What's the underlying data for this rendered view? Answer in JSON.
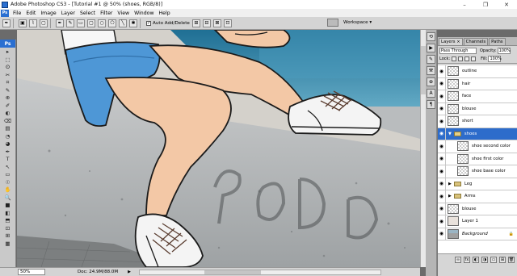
{
  "app": {
    "title": "Adobe Photoshop CS3 - [Tutorial #1 @ 50% (shoes, RGB/8)]",
    "badge": "Ps"
  },
  "window_controls": {
    "minimize": "–",
    "maximize": "❐",
    "close": "✕"
  },
  "menu": [
    "File",
    "Edit",
    "Image",
    "Layer",
    "Select",
    "Filter",
    "View",
    "Window",
    "Help"
  ],
  "options_bar": {
    "auto_add_delete_label": "Auto Add/Delete",
    "auto_add_delete_checked": true,
    "workspace_label": "Workspace ▾"
  },
  "toolbox": {
    "badge": "Ps",
    "tool_glyphs": [
      "▸",
      "⬚",
      "ʘ",
      "✂",
      "⌗",
      "✎",
      "⊕",
      "✐",
      "◐",
      "⌫",
      "▤",
      "◔",
      "◕",
      "✒",
      "T",
      "↖",
      "▭",
      "☉",
      "✋",
      "🔍",
      "■",
      "◧",
      "⬒",
      "⊡",
      "⊞",
      "▦"
    ]
  },
  "status": {
    "zoom": "50%",
    "doc": "Doc: 24.9M/88.0M"
  },
  "layers_panel": {
    "tabs": [
      "Layers ×",
      "Channels",
      "Paths"
    ],
    "active_tab": "Layers ×",
    "blend_mode": "Pass Through",
    "opacity_label": "Opacity:",
    "opacity_value": "100%",
    "lock_label": "Lock:",
    "fill_label": "Fill:",
    "fill_value": "100%",
    "layers": [
      {
        "name": "outline",
        "kind": "layer",
        "indent": false,
        "selected": false
      },
      {
        "name": "hair",
        "kind": "layer",
        "indent": false,
        "selected": false
      },
      {
        "name": "face",
        "kind": "layer",
        "indent": false,
        "selected": false
      },
      {
        "name": "blouse",
        "kind": "layer",
        "indent": false,
        "selected": false
      },
      {
        "name": "short",
        "kind": "layer",
        "indent": false,
        "selected": false
      },
      {
        "name": "shoes",
        "kind": "group-open",
        "indent": false,
        "selected": true
      },
      {
        "name": "shoe second color",
        "kind": "layer",
        "indent": true,
        "selected": false
      },
      {
        "name": "shoe first color",
        "kind": "layer",
        "indent": true,
        "selected": false
      },
      {
        "name": "shoe base color",
        "kind": "layer",
        "indent": true,
        "selected": false
      },
      {
        "name": "Leg",
        "kind": "group",
        "indent": false,
        "selected": false
      },
      {
        "name": "Arms",
        "kind": "group",
        "indent": false,
        "selected": false
      },
      {
        "name": "blouse",
        "kind": "layer",
        "indent": false,
        "selected": false
      },
      {
        "name": "Layer 1",
        "kind": "plain",
        "indent": false,
        "selected": false
      },
      {
        "name": "Background",
        "kind": "background",
        "indent": false,
        "selected": false
      }
    ]
  },
  "colors": {
    "selection": "#2d6ccb",
    "shorts": "#4e97d6",
    "skin": "#f3c8a6",
    "wall": "#b9bcbe",
    "sea": "#3e8fb0"
  }
}
